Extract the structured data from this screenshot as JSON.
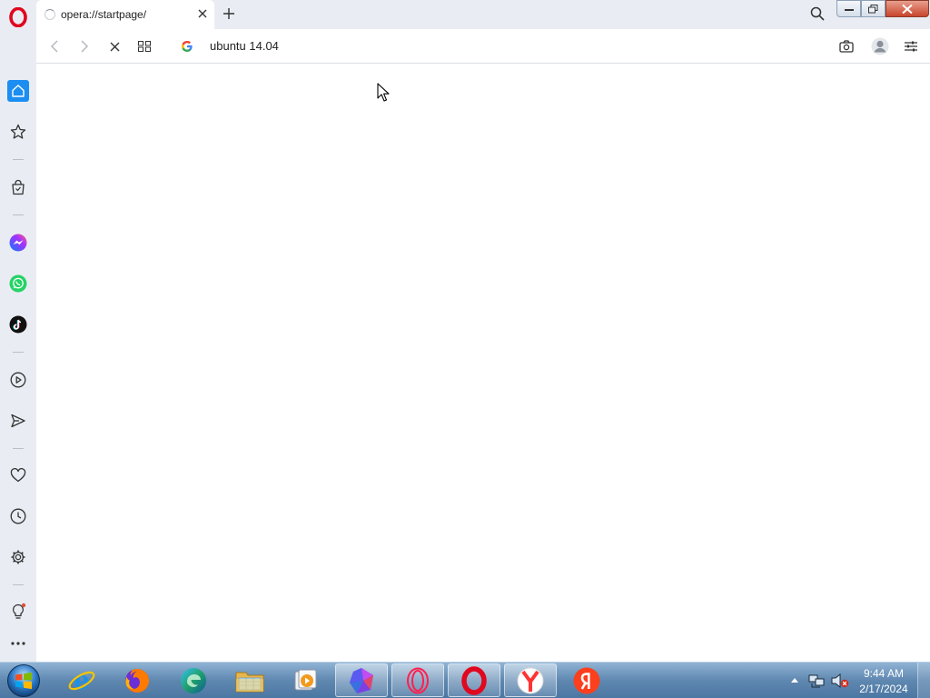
{
  "tab": {
    "title": "opera://startpage/"
  },
  "address_bar": {
    "search_engine_icon": "google-g-icon",
    "value": "ubuntu 14.04"
  },
  "sidebar": {
    "items": [
      {
        "name": "home",
        "icon": "home-icon",
        "active": true
      },
      {
        "name": "speed-dial",
        "icon": "star-icon"
      },
      {
        "name": "shopping",
        "icon": "shopping-bag-icon"
      },
      {
        "name": "messenger",
        "icon": "messenger-icon"
      },
      {
        "name": "whatsapp",
        "icon": "whatsapp-icon"
      },
      {
        "name": "tiktok",
        "icon": "tiktok-icon"
      },
      {
        "name": "player",
        "icon": "play-icon"
      },
      {
        "name": "flow",
        "icon": "send-icon"
      },
      {
        "name": "bookmarks",
        "icon": "heart-icon"
      },
      {
        "name": "history",
        "icon": "clock-icon"
      },
      {
        "name": "settings",
        "icon": "gear-icon"
      },
      {
        "name": "tips",
        "icon": "lightbulb-icon"
      },
      {
        "name": "more",
        "icon": "ellipsis-icon"
      }
    ]
  },
  "taskbar": {
    "items": [
      "internet-explorer",
      "firefox",
      "edge",
      "file-explorer",
      "media-player",
      "app-gem",
      "opera-gx",
      "opera",
      "yandex-browser",
      "yandex"
    ],
    "clock": {
      "time": "9:44 AM",
      "date": "2/17/2024"
    }
  },
  "colors": {
    "accent": "#1c8ef2",
    "opera_red": "#e0071e",
    "sidebar_bg": "#e9edf3",
    "taskbar": "#5f88b0"
  }
}
